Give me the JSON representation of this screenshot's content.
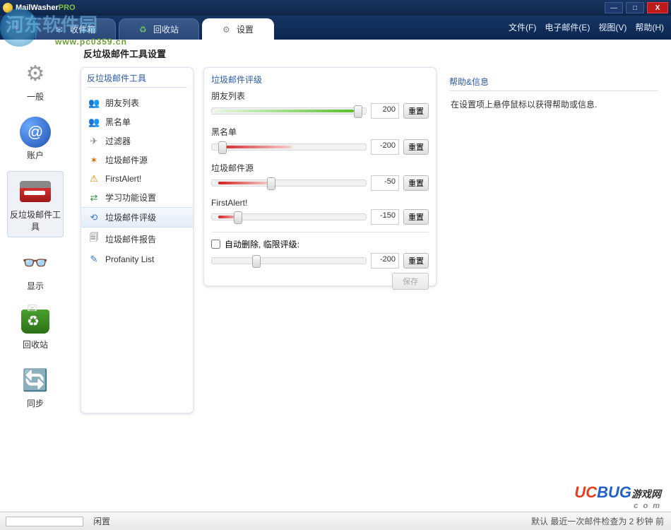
{
  "title": {
    "brand": "MailWasher",
    "suffix": "PRO"
  },
  "window_buttons": {
    "min": "—",
    "max": "□",
    "close": "X"
  },
  "tabs": {
    "inbox": "收件箱",
    "recycle": "回收站",
    "settings": "设置"
  },
  "menubar": {
    "file": "文件(F)",
    "email": "电子邮件(E)",
    "view": "视图(V)",
    "help": "帮助(H)"
  },
  "watermark1": {
    "text": "河东软件园",
    "url": "www.pc0359.cn"
  },
  "leftbar": {
    "general": "一般",
    "account": "账户",
    "spam": "反垃圾邮件工具",
    "display": "显示",
    "recycle": "回收站",
    "sync": "同步"
  },
  "page_title": "反垃圾邮件工具设置",
  "panel_tools_head": "反垃圾邮件工具",
  "toollist": [
    {
      "icon": "👥",
      "label": "朋友列表"
    },
    {
      "icon": "👥",
      "label": "黑名单",
      "c": "#555"
    },
    {
      "icon": "✈",
      "label": "过滤器",
      "c": "#888"
    },
    {
      "icon": "✶",
      "label": "垃圾邮件源",
      "c": "#d07000"
    },
    {
      "icon": "⚠",
      "label": "FirstAlert!",
      "c": "#d88000"
    },
    {
      "icon": "⇄",
      "label": "学习功能设置",
      "c": "#3a8c3a"
    },
    {
      "icon": "⟲",
      "label": "垃圾邮件评级",
      "c": "#3a78c8",
      "sel": true
    },
    {
      "icon": "🗐",
      "label": "垃圾邮件报告",
      "c": "#555"
    },
    {
      "icon": "✎",
      "label": "Profanity List",
      "c": "#3a78c8"
    }
  ],
  "panel_rating_head": "垃圾邮件评级",
  "sliders": [
    {
      "label": "朋友列表",
      "value": "200",
      "type": "green",
      "thumb": 92
    },
    {
      "label": "黑名单",
      "value": "-200",
      "type": "red",
      "fill": 48,
      "thumb": 4
    },
    {
      "label": "垃圾邮件源",
      "value": "-50",
      "type": "red",
      "fill": 34,
      "thumb": 36
    },
    {
      "label": "FirstAlert!",
      "value": "-150",
      "type": "red",
      "fill": 14,
      "thumb": 14
    }
  ],
  "reset_label": "重置",
  "auto_delete": {
    "label": "自动删除, 临限评级:",
    "value": "-200"
  },
  "save_label": "保存",
  "panel_help_head": "帮助&信息",
  "help_text": "在设置项上悬停鼠标以获得帮助或信息.",
  "status": {
    "idle": "闲置",
    "right": "默认 最近一次邮件检查为 2 秒钟 前"
  },
  "watermark2": {
    "brand": "UCBUG",
    "tail": "游戏网",
    "sub": "c o m"
  }
}
